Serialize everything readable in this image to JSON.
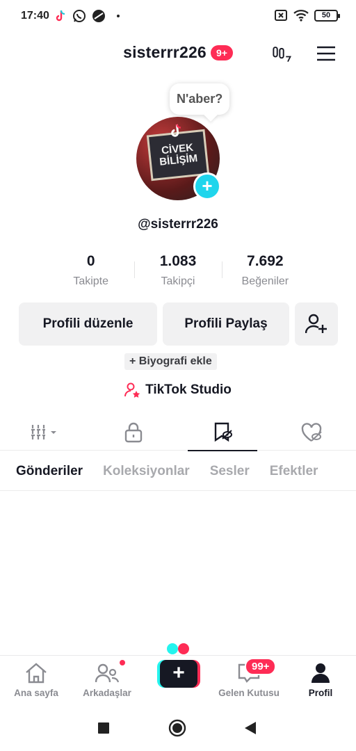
{
  "status_bar": {
    "time": "17:40",
    "battery": "50"
  },
  "header": {
    "username": "sisterrr226",
    "notification_badge": "9+"
  },
  "profile": {
    "avatar_text": [
      "CİVEK",
      "BİLİŞİM"
    ],
    "note_bubble": "N'aber?",
    "handle": "@sisterrr226",
    "stats": [
      {
        "value": "0",
        "label": "Takipte"
      },
      {
        "value": "1.083",
        "label": "Takipçi"
      },
      {
        "value": "7.692",
        "label": "Beğeniler"
      }
    ],
    "buttons": {
      "edit": "Profili düzenle",
      "share": "Profili Paylaş"
    },
    "bio_button": "+ Biyografi ekle",
    "studio_link": "TikTok Studio"
  },
  "icon_tabs": [
    {
      "icon": "grid-icon"
    },
    {
      "icon": "lock-icon"
    },
    {
      "icon": "bookmark-icon",
      "active": true
    },
    {
      "icon": "liked-hidden-icon"
    }
  ],
  "text_tabs": [
    "Gönderiler",
    "Koleksiyonlar",
    "Sesler",
    "Efektler"
  ],
  "bottom_nav": {
    "home": "Ana sayfa",
    "friends": "Arkadaşlar",
    "inbox": "Gelen Kutusu",
    "inbox_badge": "99+",
    "profile": "Profil"
  },
  "colors": {
    "accent_red": "#fe2c55",
    "accent_cyan": "#25f4ee",
    "text_dark": "#161823",
    "text_gray": "#8a8b91"
  }
}
